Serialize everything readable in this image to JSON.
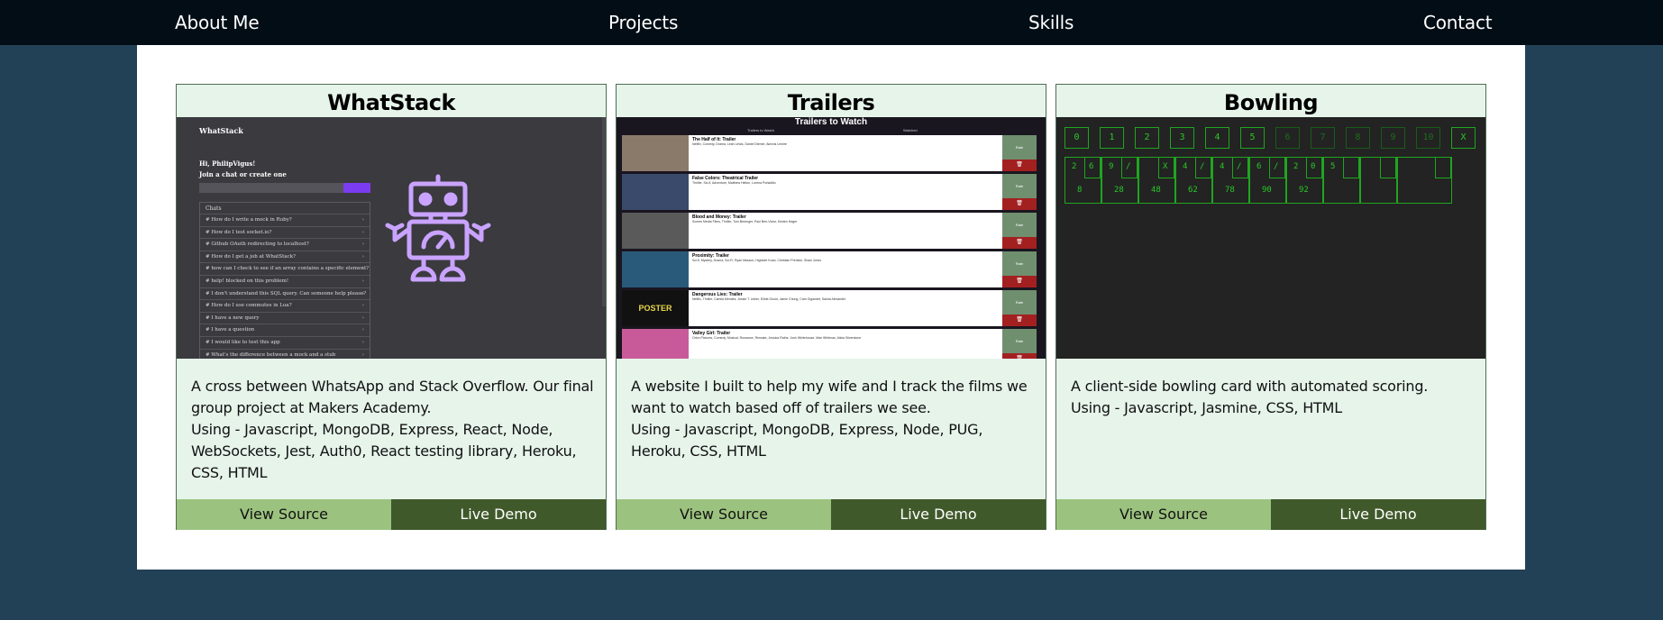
{
  "nav": {
    "about": "About Me",
    "projects": "Projects",
    "skills": "Skills",
    "contact": "Contact"
  },
  "projects": [
    {
      "title": "WhatStack",
      "description": "A cross between WhatsApp and Stack Overflow. Our final group project at Makers Academy.",
      "tech": "Using - Javascript, MongoDB, Express, React, Node, WebSockets, Jest, Auth0, React testing library, Heroku, CSS, HTML",
      "source_label": "View Source",
      "demo_label": "Live Demo",
      "preview": {
        "brand": "WhatStack",
        "greeting": "Hi, PhilipVigus!",
        "subgreeting": "Join a chat or create one",
        "list_header": "Chats",
        "chats": [
          "# How do I write a mock in Ruby?",
          "# How do I test socket.io?",
          "# Github OAuth redirecting to localhost?",
          "# How do I get a job at WhatStack?",
          "# how can I check to see if an array contains a specific element?",
          "# help! blocked on this problem!",
          "# I don't understand this SQL query. Can someone help please?",
          "# How do I use commutes in Lua?",
          "# I have a new query",
          "# I have a question",
          "# I would like to test this app",
          "# What's the difference between a mock and a stub"
        ]
      }
    },
    {
      "title": "Trailers",
      "description": "A website I built to help my wife and I track the films we want to watch based off of trailers we see.",
      "tech": "Using - Javascript, MongoDB, Express, Node, PUG, Heroku, CSS, HTML",
      "source_label": "View Source",
      "demo_label": "Live Demo",
      "preview": {
        "heading": "Trailers to Watch",
        "tab_left": "Trailers to Watch",
        "tab_right": "Watched",
        "rate_label": "Rate",
        "delete_icon": "trash-icon",
        "items": [
          {
            "title": "The Half of It: Trailer",
            "subtitle": "Netflix, Comedy, Drama, Leah Lewis, Daniel Diemer, Alexxis Lemire",
            "poster_color": "#8a7a6a"
          },
          {
            "title": "False Colors: Theatrical Trailer",
            "subtitle": "Thriller, Sci-fi, Adventure, Matthew Helton, Lorena Portadillo",
            "poster_color": "#3a4a6a"
          },
          {
            "title": "Blood and Money: Trailer",
            "subtitle": "Screen Media Films, Thriller, Tom Berenger, Paul Ben-Victor, Kristen Hager",
            "poster_color": "#5a5a5a"
          },
          {
            "title": "Proximity: Trailer",
            "subtitle": "Sci-fi, Mystery, Drama, Sci-Fi, Ryan Masson, Highdee Kuan, Christian Prentice, Shaw Jones",
            "poster_color": "#2a5a7a"
          },
          {
            "title": "Dangerous Lies: Trailer",
            "subtitle": "Netflix, Thriller, Camila Mendes, Jessie T. Usher, Elliott Gould, Jamie Chung, Cam Gigandet, Sasha Alexander",
            "poster_color": "#111111"
          },
          {
            "title": "Valley Girl: Trailer",
            "subtitle": "Orion Pictures, Comedy, Musical, Romance, Remake, Jessica Rothe, Josh Whitehouse, Mae Whitman, Alicia Silverstone",
            "poster_color": "#c85a9a"
          }
        ],
        "poster_text": "POSTER"
      }
    },
    {
      "title": "Bowling",
      "description": "A client-side bowling card with automated scoring.",
      "tech": "Using - Javascript, Jasmine, CSS, HTML",
      "source_label": "View Source",
      "demo_label": "Live Demo",
      "preview": {
        "keys": [
          "0",
          "1",
          "2",
          "3",
          "4",
          "5",
          "6",
          "7",
          "8",
          "9",
          "10",
          "X"
        ],
        "enabled_keys": 6,
        "frames": [
          {
            "rolls": [
              "2",
              "6"
            ],
            "score": "8"
          },
          {
            "rolls": [
              "9",
              "/"
            ],
            "score": "28"
          },
          {
            "rolls": [
              "",
              "X"
            ],
            "score": "48"
          },
          {
            "rolls": [
              "4",
              "/"
            ],
            "score": "62"
          },
          {
            "rolls": [
              "4",
              "/"
            ],
            "score": "78"
          },
          {
            "rolls": [
              "6",
              "/"
            ],
            "score": "90"
          },
          {
            "rolls": [
              "2",
              "0"
            ],
            "score": "92"
          },
          {
            "rolls": [
              "5",
              ""
            ],
            "score": ""
          },
          {
            "rolls": [
              "",
              ""
            ],
            "score": ""
          },
          {
            "rolls": [
              "",
              "",
              ""
            ],
            "score": ""
          }
        ],
        "accent_color": "#27c927"
      }
    }
  ]
}
